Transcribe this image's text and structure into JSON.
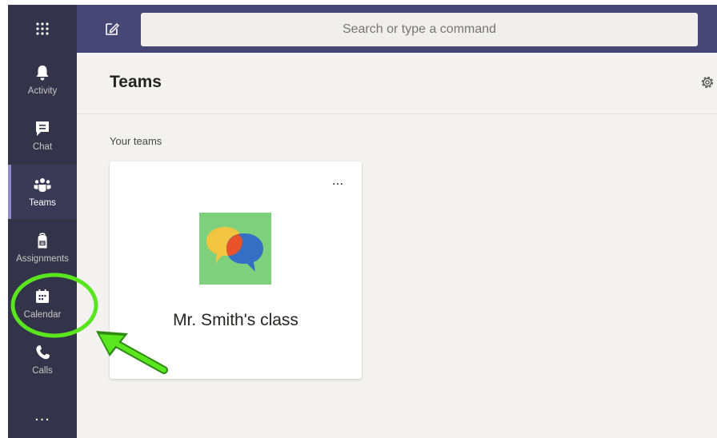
{
  "search": {
    "placeholder": "Search or type a command"
  },
  "sidebar": {
    "items": [
      {
        "label": "Activity",
        "icon": "bell-icon"
      },
      {
        "label": "Chat",
        "icon": "chat-icon"
      },
      {
        "label": "Teams",
        "icon": "teams-icon"
      },
      {
        "label": "Assignments",
        "icon": "backpack-icon"
      },
      {
        "label": "Calendar",
        "icon": "calendar-icon"
      },
      {
        "label": "Calls",
        "icon": "phone-icon"
      }
    ],
    "more": "..."
  },
  "main": {
    "title": "Teams",
    "section_label": "Your teams",
    "teams": [
      {
        "name": "Mr. Smith's class",
        "more": "..."
      }
    ]
  },
  "colors": {
    "topbar": "#464775",
    "rail": "#33344a",
    "active_indicator": "#8b8cc7",
    "team_logo_bg": "#7ed07d",
    "annotation": "#5ae61e"
  }
}
